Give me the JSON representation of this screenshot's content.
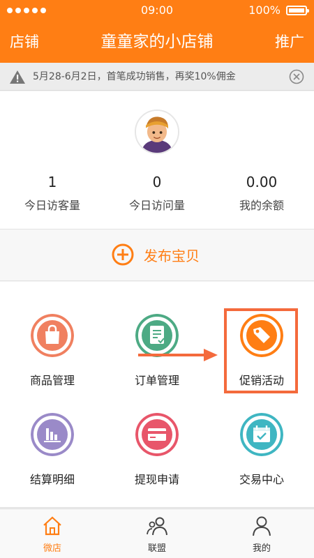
{
  "status_bar": {
    "time": "09:00",
    "battery": "100%"
  },
  "nav": {
    "left": "店铺",
    "title": "童童家的小店铺",
    "right": "推广"
  },
  "notice": {
    "text": "5月28-6月2日，首笔成功销售，再奖10%佣金"
  },
  "stats": [
    {
      "value": "1",
      "label": "今日访客量"
    },
    {
      "value": "0",
      "label": "今日访问量"
    },
    {
      "value": "0.00",
      "label": "我的余额"
    }
  ],
  "publish": {
    "label": "发布宝贝"
  },
  "menu": [
    {
      "label": "商品管理",
      "icon": "shopping-bag-icon",
      "color": "#f08060"
    },
    {
      "label": "订单管理",
      "icon": "order-clipboard-icon",
      "color": "#4daa84"
    },
    {
      "label": "促销活动",
      "icon": "price-tag-icon",
      "color": "#ff7e14"
    },
    {
      "label": "结算明细",
      "icon": "bar-chart-icon",
      "color": "#9a8ac8"
    },
    {
      "label": "提现申请",
      "icon": "credit-card-icon",
      "color": "#e8566a"
    },
    {
      "label": "交易中心",
      "icon": "calendar-check-icon",
      "color": "#3fb6c2"
    }
  ],
  "tabs": [
    {
      "label": "微店",
      "icon": "home-icon",
      "active": true
    },
    {
      "label": "联盟",
      "icon": "group-icon",
      "active": false
    },
    {
      "label": "我的",
      "icon": "user-icon",
      "active": false
    }
  ],
  "colors": {
    "brand": "#ff7e14",
    "highlight": "#f46a3c"
  }
}
